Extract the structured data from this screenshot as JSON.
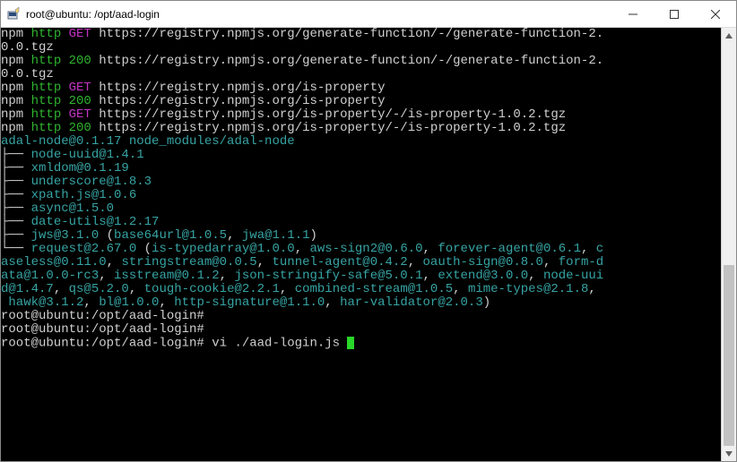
{
  "window": {
    "title": "root@ubuntu: /opt/aad-login"
  },
  "terminal": {
    "lines": [
      {
        "segments": [
          {
            "text": "npm ",
            "cls": "c-white"
          },
          {
            "text": "http ",
            "cls": "c-green"
          },
          {
            "text": "GET",
            "cls": "c-magenta"
          },
          {
            "text": " https://registry.npmjs.org/generate-function/-/generate-function-2.",
            "cls": "c-white"
          }
        ]
      },
      {
        "segments": [
          {
            "text": "0.0.tgz",
            "cls": "c-white"
          }
        ]
      },
      {
        "segments": [
          {
            "text": "npm ",
            "cls": "c-white"
          },
          {
            "text": "http ",
            "cls": "c-green"
          },
          {
            "text": "200",
            "cls": "c-green"
          },
          {
            "text": " https://registry.npmjs.org/generate-function/-/generate-function-2.",
            "cls": "c-white"
          }
        ]
      },
      {
        "segments": [
          {
            "text": "0.0.tgz",
            "cls": "c-white"
          }
        ]
      },
      {
        "segments": [
          {
            "text": "npm ",
            "cls": "c-white"
          },
          {
            "text": "http ",
            "cls": "c-green"
          },
          {
            "text": "GET",
            "cls": "c-magenta"
          },
          {
            "text": " https://registry.npmjs.org/is-property",
            "cls": "c-white"
          }
        ]
      },
      {
        "segments": [
          {
            "text": "npm ",
            "cls": "c-white"
          },
          {
            "text": "http ",
            "cls": "c-green"
          },
          {
            "text": "200",
            "cls": "c-green"
          },
          {
            "text": " https://registry.npmjs.org/is-property",
            "cls": "c-white"
          }
        ]
      },
      {
        "segments": [
          {
            "text": "npm ",
            "cls": "c-white"
          },
          {
            "text": "http ",
            "cls": "c-green"
          },
          {
            "text": "GET",
            "cls": "c-magenta"
          },
          {
            "text": " https://registry.npmjs.org/is-property/-/is-property-1.0.2.tgz",
            "cls": "c-white"
          }
        ]
      },
      {
        "segments": [
          {
            "text": "npm ",
            "cls": "c-white"
          },
          {
            "text": "http ",
            "cls": "c-green"
          },
          {
            "text": "200",
            "cls": "c-green"
          },
          {
            "text": " https://registry.npmjs.org/is-property/-/is-property-1.0.2.tgz",
            "cls": "c-white"
          }
        ]
      },
      {
        "segments": [
          {
            "text": "adal-node@0.1.17 node_modules/adal-node",
            "cls": "c-cyan"
          }
        ]
      },
      {
        "segments": [
          {
            "text": "├── ",
            "cls": "c-white"
          },
          {
            "text": "node-uuid@1.4.1",
            "cls": "c-cyan"
          }
        ]
      },
      {
        "segments": [
          {
            "text": "├── ",
            "cls": "c-white"
          },
          {
            "text": "xmldom@0.1.19",
            "cls": "c-cyan"
          }
        ]
      },
      {
        "segments": [
          {
            "text": "├── ",
            "cls": "c-white"
          },
          {
            "text": "underscore@1.8.3",
            "cls": "c-cyan"
          }
        ]
      },
      {
        "segments": [
          {
            "text": "├── ",
            "cls": "c-white"
          },
          {
            "text": "xpath.js@1.0.6",
            "cls": "c-cyan"
          }
        ]
      },
      {
        "segments": [
          {
            "text": "├── ",
            "cls": "c-white"
          },
          {
            "text": "async@1.5.0",
            "cls": "c-cyan"
          }
        ]
      },
      {
        "segments": [
          {
            "text": "├── ",
            "cls": "c-white"
          },
          {
            "text": "date-utils@1.2.17",
            "cls": "c-cyan"
          }
        ]
      },
      {
        "segments": [
          {
            "text": "├── ",
            "cls": "c-white"
          },
          {
            "text": "jws@3.1.0",
            "cls": "c-cyan"
          },
          {
            "text": " (",
            "cls": "c-white"
          },
          {
            "text": "base64url@1.0.5",
            "cls": "c-cyan"
          },
          {
            "text": ", ",
            "cls": "c-white"
          },
          {
            "text": "jwa@1.1.1",
            "cls": "c-cyan"
          },
          {
            "text": ")",
            "cls": "c-white"
          }
        ]
      },
      {
        "segments": [
          {
            "text": "└── ",
            "cls": "c-white"
          },
          {
            "text": "request@2.67.0",
            "cls": "c-cyan"
          },
          {
            "text": " (",
            "cls": "c-white"
          },
          {
            "text": "is-typedarray@1.0.0",
            "cls": "c-cyan"
          },
          {
            "text": ", ",
            "cls": "c-white"
          },
          {
            "text": "aws-sign2@0.6.0",
            "cls": "c-cyan"
          },
          {
            "text": ", ",
            "cls": "c-white"
          },
          {
            "text": "forever-agent@0.6.1",
            "cls": "c-cyan"
          },
          {
            "text": ", ",
            "cls": "c-white"
          },
          {
            "text": "c",
            "cls": "c-cyan"
          }
        ]
      },
      {
        "segments": [
          {
            "text": "aseless@0.11.0",
            "cls": "c-cyan"
          },
          {
            "text": ", ",
            "cls": "c-white"
          },
          {
            "text": "stringstream@0.0.5",
            "cls": "c-cyan"
          },
          {
            "text": ", ",
            "cls": "c-white"
          },
          {
            "text": "tunnel-agent@0.4.2",
            "cls": "c-cyan"
          },
          {
            "text": ", ",
            "cls": "c-white"
          },
          {
            "text": "oauth-sign@0.8.0",
            "cls": "c-cyan"
          },
          {
            "text": ", ",
            "cls": "c-white"
          },
          {
            "text": "form-d",
            "cls": "c-cyan"
          }
        ]
      },
      {
        "segments": [
          {
            "text": "ata@1.0.0-rc3",
            "cls": "c-cyan"
          },
          {
            "text": ", ",
            "cls": "c-white"
          },
          {
            "text": "isstream@0.1.2",
            "cls": "c-cyan"
          },
          {
            "text": ", ",
            "cls": "c-white"
          },
          {
            "text": "json-stringify-safe@5.0.1",
            "cls": "c-cyan"
          },
          {
            "text": ", ",
            "cls": "c-white"
          },
          {
            "text": "extend@3.0.0",
            "cls": "c-cyan"
          },
          {
            "text": ", ",
            "cls": "c-white"
          },
          {
            "text": "node-uui",
            "cls": "c-cyan"
          }
        ]
      },
      {
        "segments": [
          {
            "text": "d@1.4.7",
            "cls": "c-cyan"
          },
          {
            "text": ", ",
            "cls": "c-white"
          },
          {
            "text": "qs@5.2.0",
            "cls": "c-cyan"
          },
          {
            "text": ", ",
            "cls": "c-white"
          },
          {
            "text": "tough-cookie@2.2.1",
            "cls": "c-cyan"
          },
          {
            "text": ", ",
            "cls": "c-white"
          },
          {
            "text": "combined-stream@1.0.5",
            "cls": "c-cyan"
          },
          {
            "text": ", ",
            "cls": "c-white"
          },
          {
            "text": "mime-types@2.1.8",
            "cls": "c-cyan"
          },
          {
            "text": ",",
            "cls": "c-white"
          }
        ]
      },
      {
        "segments": [
          {
            "text": " ",
            "cls": "c-white"
          },
          {
            "text": "hawk@3.1.2",
            "cls": "c-cyan"
          },
          {
            "text": ", ",
            "cls": "c-white"
          },
          {
            "text": "bl@1.0.0",
            "cls": "c-cyan"
          },
          {
            "text": ", ",
            "cls": "c-white"
          },
          {
            "text": "http-signature@1.1.0",
            "cls": "c-cyan"
          },
          {
            "text": ", ",
            "cls": "c-white"
          },
          {
            "text": "har-validator@2.0.3",
            "cls": "c-cyan"
          },
          {
            "text": ")",
            "cls": "c-white"
          }
        ]
      },
      {
        "segments": [
          {
            "text": "root@ubuntu:/opt/aad-login#",
            "cls": "c-white"
          }
        ]
      },
      {
        "segments": [
          {
            "text": "root@ubuntu:/opt/aad-login#",
            "cls": "c-white"
          }
        ]
      }
    ],
    "promptPrefix": "root@ubuntu:/opt/aad-login#",
    "promptCommand": " vi ./aad-login.js "
  }
}
